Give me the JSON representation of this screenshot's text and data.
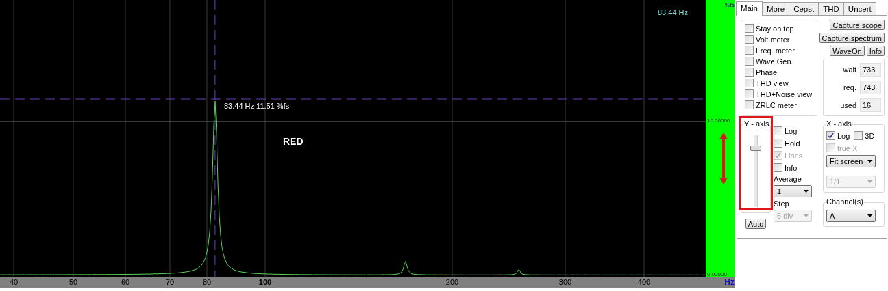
{
  "plot": {
    "cursor_readout": "83.44 Hz",
    "marker_label": "83.44 Hz 11.51 %fs",
    "annotation": "RED"
  },
  "y_scale": {
    "unit": "%fs",
    "top_label": "10.00000",
    "bottom_label": "0.00000"
  },
  "x_axis": {
    "unit": "Hz",
    "ticks": [
      {
        "label": "40",
        "major": false
      },
      {
        "label": "50",
        "major": false
      },
      {
        "label": "60",
        "major": false
      },
      {
        "label": "70",
        "major": false
      },
      {
        "label": "80",
        "major": false
      },
      {
        "label": "100",
        "major": true
      },
      {
        "label": "200",
        "major": false
      },
      {
        "label": "300",
        "major": false
      },
      {
        "label": "400",
        "major": false
      }
    ]
  },
  "tabs": [
    {
      "label": "Main",
      "selected": true
    },
    {
      "label": "More",
      "selected": false
    },
    {
      "label": "Cepst",
      "selected": false
    },
    {
      "label": "THD",
      "selected": false
    },
    {
      "label": "Uncert",
      "selected": false
    }
  ],
  "views": [
    {
      "label": "Stay on top",
      "checked": false
    },
    {
      "label": "Volt meter",
      "checked": false
    },
    {
      "label": "Freq. meter",
      "checked": false
    },
    {
      "label": "Wave Gen.",
      "checked": false
    },
    {
      "label": "Phase",
      "checked": false
    },
    {
      "label": "THD view",
      "checked": false
    },
    {
      "label": "THD+Noise view",
      "checked": false
    },
    {
      "label": "ZRLC meter",
      "checked": false
    }
  ],
  "buttons": [
    "Capture scope",
    "Capture spectrum",
    "WaveOn",
    "Info"
  ],
  "buffer": [
    {
      "label": "wait",
      "value": "733"
    },
    {
      "label": "req.",
      "value": "743"
    },
    {
      "label": "used",
      "value": "16"
    }
  ],
  "y_axis": {
    "title": "Y - axis",
    "level": 0.85,
    "auto_button": "Auto"
  },
  "display": [
    {
      "label": "Log",
      "checked": false,
      "disabled": false
    },
    {
      "label": "Hold",
      "checked": false,
      "disabled": false
    },
    {
      "label": "Lines",
      "checked": true,
      "disabled": true
    },
    {
      "label": "Info",
      "checked": false,
      "disabled": false
    }
  ],
  "average": {
    "label": "Average",
    "value": "1",
    "disabled": false
  },
  "step": {
    "label": "Step",
    "value": "6 div",
    "disabled": true
  },
  "x_axis_group": {
    "title": "X - axis",
    "options": [
      {
        "label": "Log",
        "checked": true,
        "disabled": false
      },
      {
        "label": "3D",
        "checked": false,
        "disabled": false
      },
      {
        "label": "true X",
        "checked": false,
        "disabled": true
      }
    ],
    "scale": {
      "value": "Fit screen",
      "disabled": false
    },
    "ratio": {
      "value": "1/1",
      "disabled": true
    }
  },
  "channels": {
    "title": "Channel(s)",
    "value": "A",
    "disabled": false
  }
}
